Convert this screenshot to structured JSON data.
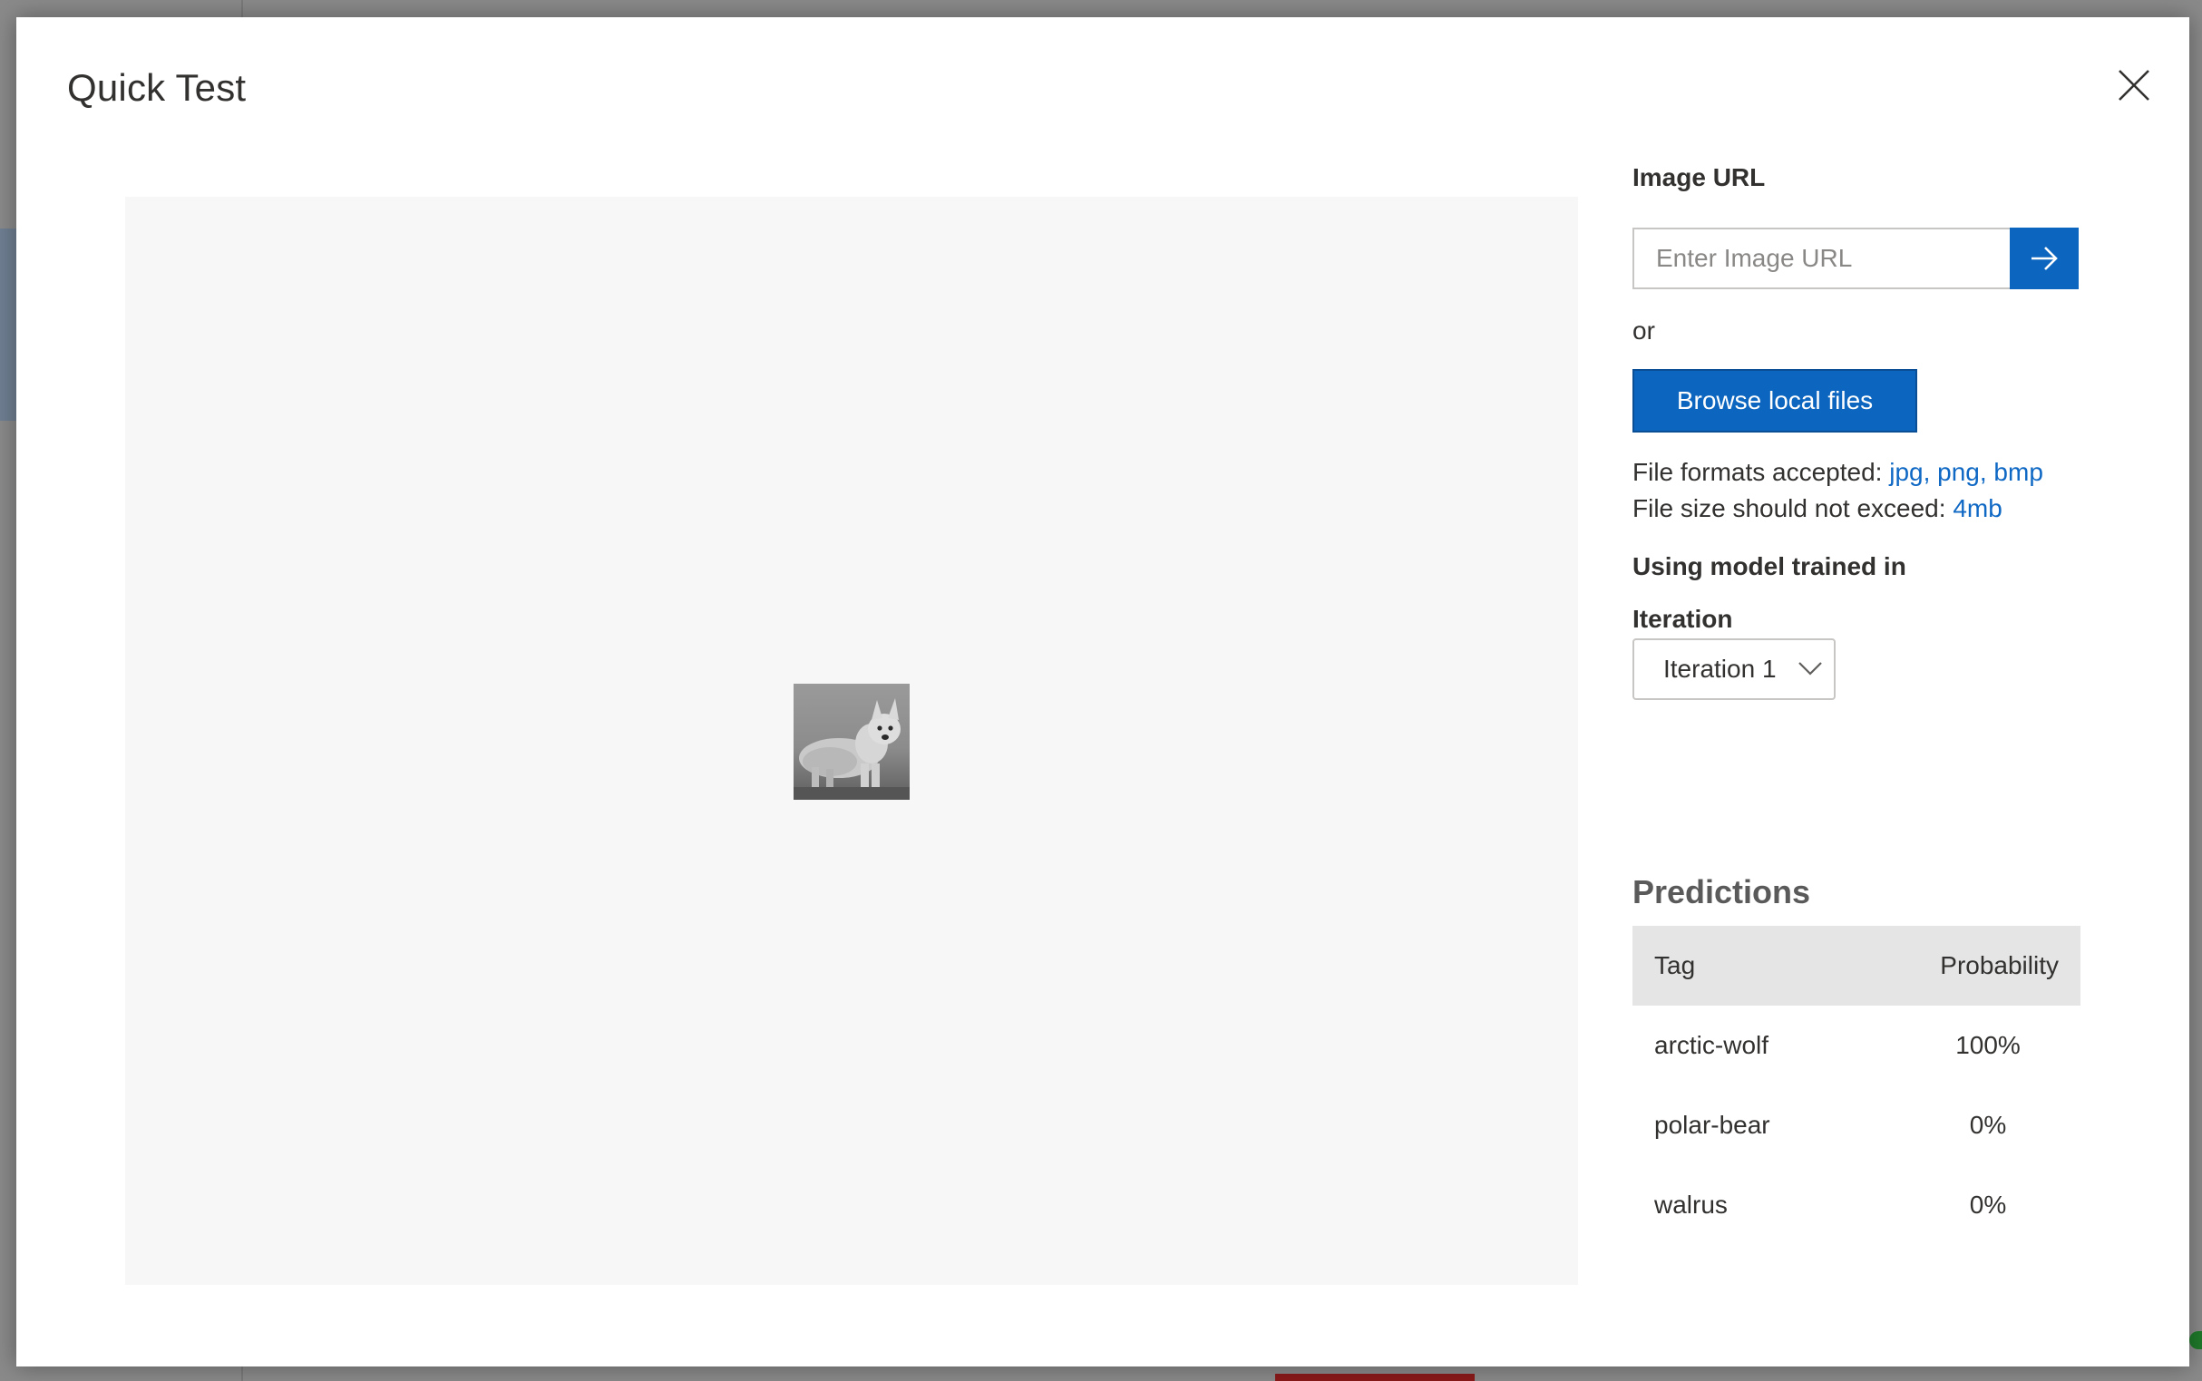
{
  "modal": {
    "title": "Quick Test",
    "close_icon": "close-icon"
  },
  "image_url": {
    "label": "Image URL",
    "placeholder": "Enter Image URL",
    "value": "",
    "submit_icon": "arrow-right-icon"
  },
  "or_text": "or",
  "browse_button": "Browse local files",
  "file_info": {
    "formats_label": "File formats accepted:",
    "formats_value": "jpg, png, bmp",
    "size_label": "File size should not exceed:",
    "size_value": "4mb"
  },
  "model": {
    "heading": "Using model trained in",
    "iteration_label": "Iteration",
    "iteration_selected": "Iteration 1"
  },
  "predictions": {
    "title": "Predictions",
    "columns": [
      "Tag",
      "Probability"
    ],
    "rows": [
      {
        "tag": "arctic-wolf",
        "probability": "100%"
      },
      {
        "tag": "polar-bear",
        "probability": "0%"
      },
      {
        "tag": "walrus",
        "probability": "0%"
      }
    ]
  },
  "colors": {
    "accent": "#0c65be",
    "link": "#0f68c4",
    "preview_bg": "#f7f7f7",
    "table_header_bg": "#e5e5e5"
  }
}
